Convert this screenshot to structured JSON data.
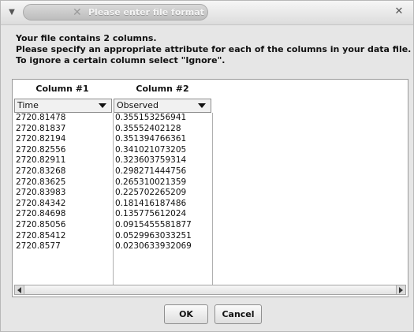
{
  "window": {
    "title": "Please enter file format",
    "menu_icon": "chevron-down-icon",
    "close_icon": "close-icon"
  },
  "message": {
    "line1": "Your file contains 2 columns.",
    "line2": "Please specify an appropriate attribute for each of the columns in your data file.",
    "line3": "To ignore a certain column select \"Ignore\"."
  },
  "table": {
    "columns": [
      {
        "header": "Column #1",
        "selected": "Time"
      },
      {
        "header": "Column #2",
        "selected": "Observed"
      }
    ],
    "rows": [
      [
        "2720.81478",
        "0.355153256941"
      ],
      [
        "2720.81837",
        "0.35552402128"
      ],
      [
        "2720.82194",
        "0.351394766361"
      ],
      [
        "2720.82556",
        "0.341021073205"
      ],
      [
        "2720.82911",
        "0.323603759314"
      ],
      [
        "2720.83268",
        "0.298271444756"
      ],
      [
        "2720.83625",
        "0.265310021359"
      ],
      [
        "2720.83983",
        "0.225702265209"
      ],
      [
        "2720.84342",
        "0.181416187486"
      ],
      [
        "2720.84698",
        "0.135775612024"
      ],
      [
        "2720.85056",
        "0.0915455581877"
      ],
      [
        "2720.85412",
        "0.0529963033251"
      ],
      [
        "2720.8577",
        "0.0230633932069"
      ]
    ]
  },
  "buttons": {
    "ok": "OK",
    "cancel": "Cancel"
  }
}
